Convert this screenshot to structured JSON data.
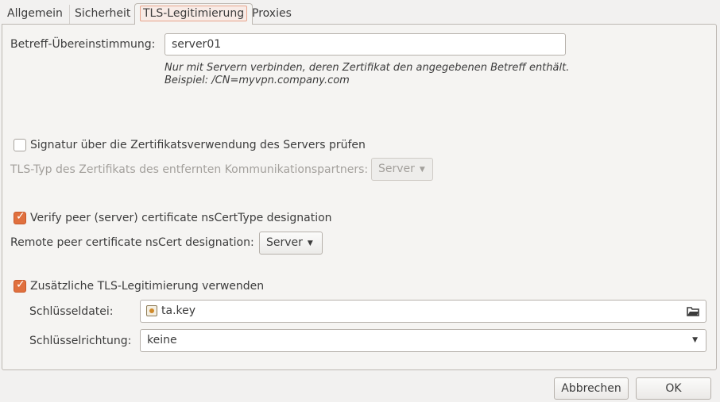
{
  "tabs": [
    {
      "label": "Allgemein"
    },
    {
      "label": "Sicherheit"
    },
    {
      "label": "TLS-Legitimierung"
    },
    {
      "label": "Proxies"
    }
  ],
  "subject_match": {
    "label": "Betreff-Übereinstimmung:",
    "value": "server01",
    "hint_line1": "Nur mit Servern verbinden, deren Zertifikat den angegebenen Betreff enthält.",
    "hint_line2": "Beispiel: /CN=myvpn.company.com"
  },
  "verify_key_usage": {
    "label": "Signatur über die Zertifikatsverwendung des Servers prüfen",
    "checked": false
  },
  "remote_tls_type": {
    "label": "TLS-Typ des Zertifikats des entfernten Kommunikationspartners:",
    "value": "Server"
  },
  "verify_nscerttype": {
    "label": "Verify peer (server) certificate nsCertType designation",
    "checked": true
  },
  "nscert_designation": {
    "label": "Remote peer certificate nsCert designation:",
    "value": "Server"
  },
  "extra_tls_auth": {
    "label": "Zusätzliche TLS-Legitimierung verwenden",
    "checked": true
  },
  "key_file": {
    "label": "Schlüsseldatei:",
    "value": "ta.key"
  },
  "key_direction": {
    "label": "Schlüsselrichtung:",
    "value": "keine"
  },
  "buttons": {
    "cancel": "Abbrechen",
    "ok": "OK"
  },
  "colors": {
    "accent": "#e0703e",
    "background": "#f2f1f0"
  }
}
